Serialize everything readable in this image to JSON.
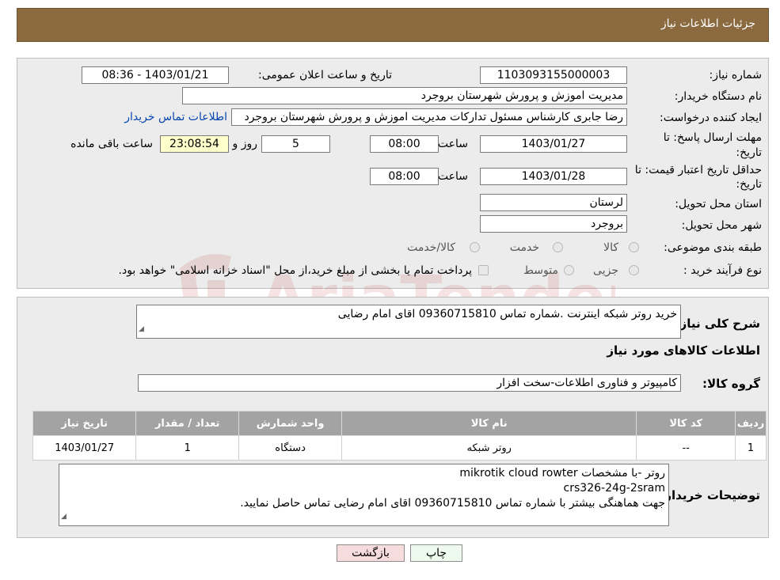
{
  "header": {
    "title": "جزئیات اطلاعات نیاز"
  },
  "form": {
    "need_number_label": "شماره نیاز:",
    "need_number": "1103093155000003",
    "announce_label": "تاریخ و ساعت اعلان عمومی:",
    "announce_value": "1403/01/21 - 08:36",
    "buyer_org_label": "نام دستگاه خریدار:",
    "buyer_org": "مدیریت اموزش و پرورش شهرستان بروجرد",
    "creator_label": "ایجاد کننده درخواست:",
    "creator": "رضا جابری کارشناس مسئول تدارکات مدیریت اموزش و پرورش شهرستان بروجرد",
    "contact_link": "اطلاعات تماس خریدار",
    "deadline_label_1": "مهلت ارسال پاسخ: تا",
    "deadline_label_2": "تاریخ:",
    "deadline_date": "1403/01/27",
    "time_label": "ساعت",
    "deadline_time": "08:00",
    "days": "5",
    "days_label": "روز و",
    "remaining": "23:08:54",
    "remaining_label": "ساعت باقی مانده",
    "validity_label_1": "حداقل تاریخ اعتبار قیمت: تا",
    "validity_label_2": "تاریخ:",
    "validity_date": "1403/01/28",
    "validity_time": "08:00",
    "province_label": "استان محل تحویل:",
    "province": "لرستان",
    "city_label": "شهر محل تحویل:",
    "city": "بروجرد",
    "category_label": "طبقه بندی موضوعی:",
    "category_options": [
      "کالا",
      "خدمت",
      "کالا/خدمت"
    ],
    "process_label": "نوع فرآیند خرید :",
    "process_options": [
      "جزیی",
      "متوسط"
    ],
    "process_note": "پرداخت تمام یا بخشی از مبلغ خرید،از محل \"اسناد خزانه اسلامی\" خواهد بود."
  },
  "details": {
    "description_label": "شرح کلی نیاز:",
    "description": "خرید روتر شبکه اینترنت .شماره تماس 09360715810 اقای امام رضایی",
    "goods_info_title": "اطلاعات کالاهای مورد نیاز",
    "goods_group_label": "گروه کالا:",
    "goods_group": "کامپیوتر و فناوری اطلاعات-سخت افزار",
    "table": {
      "headers": [
        "ردیف",
        "کد کالا",
        "نام کالا",
        "واحد شمارش",
        "تعداد / مقدار",
        "تاریخ نیاز"
      ],
      "rows": [
        [
          "1",
          "--",
          "روتر شبکه",
          "دستگاه",
          "1",
          "1403/01/27"
        ]
      ]
    },
    "buyer_notes_label": "توضیحات خریدار:",
    "buyer_notes_lines": [
      "روتر -با مشخصات mikrotik cloud rowter",
      "crs326-24g-2sram",
      "جهت هماهنگی بیشتر با شماره تماس 09360715810 اقای امام رضایی تماس حاصل نمایید."
    ]
  },
  "buttons": {
    "print": "چاپ",
    "back": "بازگشت"
  },
  "watermark": "AriaTender.neT",
  "colors": {
    "header": "#8b6a3f",
    "panel": "#ececec",
    "table_header": "#a3a3a3",
    "link": "#0645ad",
    "remaining_bg": "#ffffcc",
    "back_btn_bg": "#f6dcdc"
  }
}
